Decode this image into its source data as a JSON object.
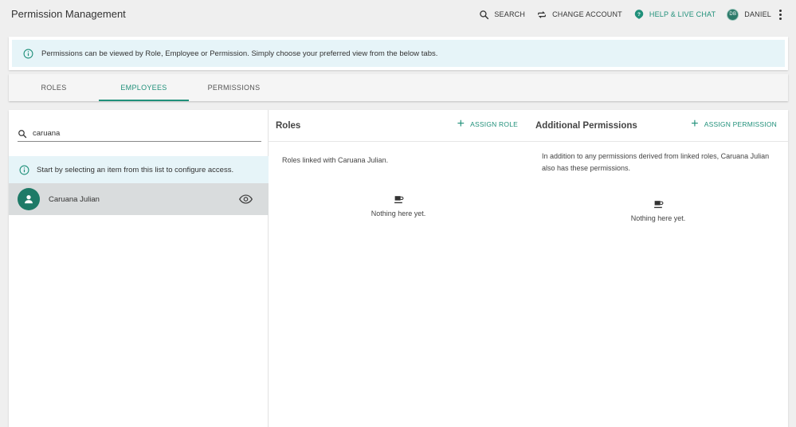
{
  "app": {
    "title": "Permission Management"
  },
  "topbar": {
    "search_label": "SEARCH",
    "change_account_label": "CHANGE ACCOUNT",
    "help_label": "HELP & LIVE CHAT",
    "user_initials": "DB",
    "user_name": "DANIEL",
    "accent_color": "#20907a"
  },
  "info": {
    "message": "Permissions can be viewed by Role, Employee or Permission. Simply choose your preferred view from the below tabs."
  },
  "tabs": [
    {
      "label": "ROLES",
      "active": false
    },
    {
      "label": "EMPLOYEES",
      "active": true
    },
    {
      "label": "PERMISSIONS",
      "active": false
    }
  ],
  "left": {
    "search_value": "caruana",
    "hint": "Start by selecting an item from this list to configure access.",
    "employees": [
      {
        "name": "Caruana Julian",
        "selected": true
      }
    ]
  },
  "roles": {
    "title": "Roles",
    "assign_label": "ASSIGN ROLE",
    "description": "Roles linked with Caruana Julian.",
    "empty_text": "Nothing here yet."
  },
  "permissions": {
    "title": "Additional Permissions",
    "assign_label": "ASSIGN PERMISSION",
    "description": "In addition to any permissions derived from linked roles, Caruana Julian also has these permissions.",
    "empty_text": "Nothing here yet."
  }
}
